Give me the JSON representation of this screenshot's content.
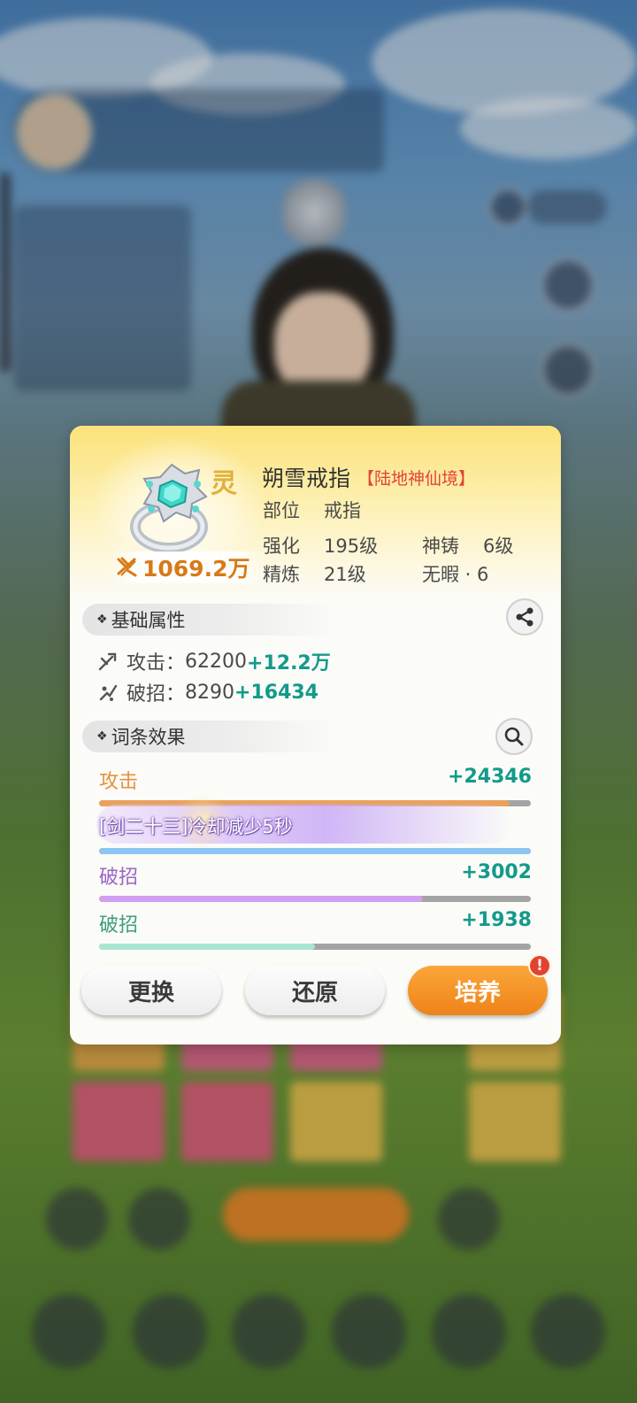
{
  "item": {
    "badge": "灵",
    "power": "1069.2万",
    "name": "朔雪戒指",
    "rank": "【陆地神仙境】",
    "slot_label": "部位",
    "slot_value": "戒指",
    "enhance_label": "强化",
    "enhance_value": "195级",
    "forge_label": "神铸",
    "forge_value": "6级",
    "refine_label": "精炼",
    "refine_value": "21级",
    "flawless": "无暇 · 6"
  },
  "base_attrs": {
    "title": "基础属性",
    "share_icon": "share-icon",
    "rows": [
      {
        "label": "攻击：",
        "value": "62200",
        "bonus": "+12.2万",
        "icon": "attack-icon"
      },
      {
        "label": "破招：",
        "value": "8290",
        "bonus": "+16434",
        "icon": "break-icon"
      }
    ]
  },
  "affixes": {
    "title": "词条效果",
    "search_icon": "magnifier-icon",
    "rows": [
      {
        "label": "攻击",
        "value": "+24346",
        "fill": 0.95,
        "label_color": "#e8913a",
        "bar_color": "#e8a25e"
      },
      {
        "label": "[剑二十三]冷却减少5秒",
        "special": true,
        "fill": 1.0,
        "bar_color": "#8cc4f2"
      },
      {
        "label": "破招",
        "value": "+3002",
        "fill": 0.75,
        "label_color": "#9a64c8",
        "bar_color": "#cfa0ef"
      },
      {
        "label": "破招",
        "value": "+1938",
        "fill": 0.5,
        "label_color": "#3f9c7e",
        "bar_color": "#a9e6d2"
      }
    ]
  },
  "actions": {
    "replace": "更换",
    "restore": "还原",
    "cultivate": "培养",
    "alert": "!"
  },
  "colors": {
    "accent_orange": "#ee8318",
    "bonus_green": "#139a8a",
    "rank_red": "#e2433a",
    "power_orange": "#d77a18"
  }
}
